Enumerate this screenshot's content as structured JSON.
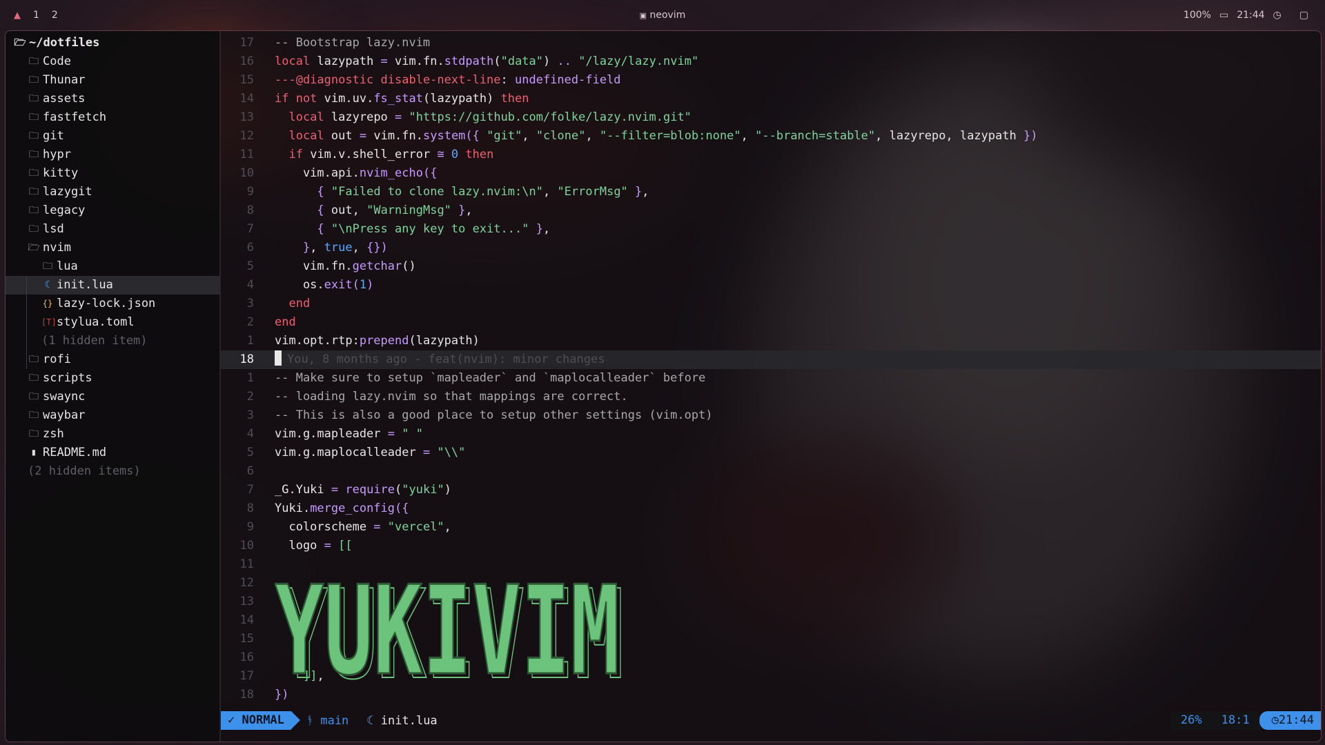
{
  "topbar": {
    "workspaces": [
      "1",
      "2"
    ],
    "title": "neovim",
    "battery": "100%",
    "clock": "21:44"
  },
  "tree": {
    "root": "~/dotfiles",
    "items": [
      {
        "label": "Code",
        "type": "dir",
        "depth": 1
      },
      {
        "label": "Thunar",
        "type": "dir",
        "depth": 1
      },
      {
        "label": "assets",
        "type": "dir",
        "depth": 1
      },
      {
        "label": "fastfetch",
        "type": "dir",
        "depth": 1
      },
      {
        "label": "git",
        "type": "dir",
        "depth": 1
      },
      {
        "label": "hypr",
        "type": "dir",
        "depth": 1
      },
      {
        "label": "kitty",
        "type": "dir",
        "depth": 1
      },
      {
        "label": "lazygit",
        "type": "dir",
        "depth": 1
      },
      {
        "label": "legacy",
        "type": "dir",
        "depth": 1
      },
      {
        "label": "lsd",
        "type": "dir",
        "depth": 1
      },
      {
        "label": "nvim",
        "type": "dir-open",
        "depth": 1
      },
      {
        "label": "lua",
        "type": "dir",
        "depth": 2
      },
      {
        "label": "init.lua",
        "type": "lua",
        "depth": 2,
        "selected": true
      },
      {
        "label": "lazy-lock.json",
        "type": "json",
        "depth": 2
      },
      {
        "label": "stylua.toml",
        "type": "toml",
        "depth": 2
      },
      {
        "label": "(1 hidden item)",
        "type": "hidden",
        "depth": 2
      },
      {
        "label": "rofi",
        "type": "dir",
        "depth": 1
      },
      {
        "label": "scripts",
        "type": "dir",
        "depth": 1
      },
      {
        "label": "swaync",
        "type": "dir",
        "depth": 1
      },
      {
        "label": "waybar",
        "type": "dir",
        "depth": 1
      },
      {
        "label": "zsh",
        "type": "dir",
        "depth": 1
      },
      {
        "label": "README.md",
        "type": "md",
        "depth": 1
      },
      {
        "label": "(2 hidden items)",
        "type": "hidden",
        "depth": 1
      }
    ]
  },
  "editor": {
    "lines": [
      {
        "n": "17",
        "parts": [
          [
            "c-com",
            "-- Bootstrap lazy.nvim"
          ]
        ]
      },
      {
        "n": "16",
        "parts": [
          [
            "c-kw",
            "local "
          ],
          [
            "",
            "lazypath "
          ],
          [
            "c-pun",
            "= "
          ],
          [
            "",
            "vim.fn."
          ],
          [
            "c-fn",
            "stdpath"
          ],
          [
            "",
            "("
          ],
          [
            "c-str",
            "\"data\""
          ],
          [
            "",
            ") "
          ],
          [
            "c-pun",
            ".. "
          ],
          [
            "c-str",
            "\"/lazy/lazy.nvim\""
          ]
        ]
      },
      {
        "n": "15",
        "parts": [
          [
            "c-kw",
            "---@diagnostic "
          ],
          [
            "c-kw",
            "disable-next-line"
          ],
          [
            "",
            ": "
          ],
          [
            "c-fn",
            "undefined-field"
          ]
        ]
      },
      {
        "n": "14",
        "parts": [
          [
            "c-kw",
            "if not "
          ],
          [
            "",
            "vim.uv."
          ],
          [
            "c-fn",
            "fs_stat"
          ],
          [
            "",
            "(lazypath) "
          ],
          [
            "c-kw",
            "then"
          ]
        ]
      },
      {
        "n": "13",
        "parts": [
          [
            "",
            "  "
          ],
          [
            "c-kw",
            "local "
          ],
          [
            "",
            "lazyrepo "
          ],
          [
            "c-pun",
            "= "
          ],
          [
            "c-str",
            "\"https://github.com/folke/lazy.nvim.git\""
          ]
        ]
      },
      {
        "n": "12",
        "parts": [
          [
            "",
            "  "
          ],
          [
            "c-kw",
            "local "
          ],
          [
            "",
            "out "
          ],
          [
            "c-pun",
            "= "
          ],
          [
            "",
            "vim.fn."
          ],
          [
            "c-fn",
            "system"
          ],
          [
            "c-pun",
            "({ "
          ],
          [
            "c-str",
            "\"git\""
          ],
          [
            "",
            ", "
          ],
          [
            "c-str",
            "\"clone\""
          ],
          [
            "",
            ", "
          ],
          [
            "c-str",
            "\"--filter=blob:none\""
          ],
          [
            "",
            ", "
          ],
          [
            "c-str",
            "\"--branch=stable\""
          ],
          [
            "",
            ", lazyrepo, lazypath "
          ],
          [
            "c-pun",
            "})"
          ]
        ]
      },
      {
        "n": "11",
        "parts": [
          [
            "",
            "  "
          ],
          [
            "c-kw",
            "if "
          ],
          [
            "",
            "vim.v.shell_error "
          ],
          [
            "c-pun",
            "≅ "
          ],
          [
            "c-num",
            "0 "
          ],
          [
            "c-kw",
            "then"
          ]
        ]
      },
      {
        "n": "10",
        "parts": [
          [
            "",
            "    vim.api."
          ],
          [
            "c-fn",
            "nvim_echo"
          ],
          [
            "c-pun",
            "({"
          ]
        ]
      },
      {
        "n": "9",
        "parts": [
          [
            "",
            "      "
          ],
          [
            "c-pun",
            "{ "
          ],
          [
            "c-str",
            "\"Failed to clone lazy.nvim:\\n\""
          ],
          [
            "",
            ", "
          ],
          [
            "c-str",
            "\"ErrorMsg\""
          ],
          [
            "c-pun",
            " }"
          ],
          [
            "",
            ","
          ]
        ]
      },
      {
        "n": "8",
        "parts": [
          [
            "",
            "      "
          ],
          [
            "c-pun",
            "{ "
          ],
          [
            "",
            "out, "
          ],
          [
            "c-str",
            "\"WarningMsg\""
          ],
          [
            "c-pun",
            " }"
          ],
          [
            "",
            ","
          ]
        ]
      },
      {
        "n": "7",
        "parts": [
          [
            "",
            "      "
          ],
          [
            "c-pun",
            "{ "
          ],
          [
            "c-str",
            "\"\\nPress any key to exit...\""
          ],
          [
            "c-pun",
            " }"
          ],
          [
            "",
            ","
          ]
        ]
      },
      {
        "n": "6",
        "parts": [
          [
            "",
            "    "
          ],
          [
            "c-pun",
            "}"
          ],
          [
            "",
            ", "
          ],
          [
            "c-num",
            "true"
          ],
          [
            "",
            ", "
          ],
          [
            "c-pun",
            "{})"
          ]
        ]
      },
      {
        "n": "5",
        "parts": [
          [
            "",
            "    vim.fn."
          ],
          [
            "c-fn",
            "getchar"
          ],
          [
            "",
            "()"
          ]
        ]
      },
      {
        "n": "4",
        "parts": [
          [
            "",
            "    os."
          ],
          [
            "c-fn",
            "exit"
          ],
          [
            "c-pun",
            "("
          ],
          [
            "c-num",
            "1"
          ],
          [
            "c-pun",
            ")"
          ]
        ]
      },
      {
        "n": "3",
        "parts": [
          [
            "",
            "  "
          ],
          [
            "c-kw",
            "end"
          ]
        ]
      },
      {
        "n": "2",
        "parts": [
          [
            "c-kw",
            "end"
          ]
        ]
      },
      {
        "n": "1",
        "parts": [
          [
            "",
            "vim.opt.rtp:"
          ],
          [
            "c-fn",
            "prepend"
          ],
          [
            "",
            "(lazypath)"
          ]
        ]
      },
      {
        "n": "18",
        "current": true,
        "blame": "You, 8 months ago - feat(nvim): minor changes"
      },
      {
        "n": "1",
        "parts": [
          [
            "c-com",
            "-- Make sure to setup `mapleader` and `maplocalleader` before"
          ]
        ]
      },
      {
        "n": "2",
        "parts": [
          [
            "c-com",
            "-- loading lazy.nvim so that mappings are correct."
          ]
        ]
      },
      {
        "n": "3",
        "parts": [
          [
            "c-com",
            "-- This is also a good place to setup other settings (vim.opt)"
          ]
        ]
      },
      {
        "n": "4",
        "parts": [
          [
            "",
            "vim.g.mapleader "
          ],
          [
            "c-pun",
            "= "
          ],
          [
            "c-str",
            "\" \""
          ]
        ]
      },
      {
        "n": "5",
        "parts": [
          [
            "",
            "vim.g.maplocalleader "
          ],
          [
            "c-pun",
            "= "
          ],
          [
            "c-str",
            "\"\\\\\""
          ]
        ]
      },
      {
        "n": "6",
        "parts": []
      },
      {
        "n": "7",
        "parts": [
          [
            "",
            "_G.Yuki "
          ],
          [
            "c-pun",
            "= "
          ],
          [
            "c-fn",
            "require"
          ],
          [
            "",
            "("
          ],
          [
            "c-str",
            "\"yuki\""
          ],
          [
            "",
            ")"
          ]
        ]
      },
      {
        "n": "8",
        "parts": [
          [
            "",
            "Yuki."
          ],
          [
            "c-fn",
            "merge_config"
          ],
          [
            "c-pun",
            "({"
          ]
        ]
      },
      {
        "n": "9",
        "parts": [
          [
            "",
            "  colorscheme "
          ],
          [
            "c-pun",
            "= "
          ],
          [
            "c-str",
            "\"vercel\""
          ],
          [
            "",
            ","
          ]
        ]
      },
      {
        "n": "10",
        "parts": [
          [
            "",
            "  logo "
          ],
          [
            "c-pun",
            "= "
          ],
          [
            "c-str",
            "[["
          ]
        ]
      },
      {
        "n": "11",
        "parts": []
      },
      {
        "n": "12",
        "parts": []
      },
      {
        "n": "13",
        "parts": []
      },
      {
        "n": "14",
        "parts": []
      },
      {
        "n": "15",
        "parts": []
      },
      {
        "n": "16",
        "parts": []
      },
      {
        "n": "17",
        "parts": [
          [
            "",
            "    "
          ],
          [
            "c-str",
            "]]"
          ],
          [
            "",
            ","
          ]
        ]
      },
      {
        "n": "18",
        "parts": [
          [
            "c-pun",
            "})"
          ]
        ]
      }
    ],
    "logo_text": "YUKIVIM"
  },
  "statusline": {
    "mode": "NORMAL",
    "branch": "main",
    "file": "init.lua",
    "percent": "26%",
    "position": "18:1",
    "time": "21:44"
  },
  "colors": {
    "accent": "#3d91ea",
    "keyword": "#ef5f72",
    "string": "#7ed49a",
    "function": "#c79aff",
    "logo": "#6cc47c"
  }
}
